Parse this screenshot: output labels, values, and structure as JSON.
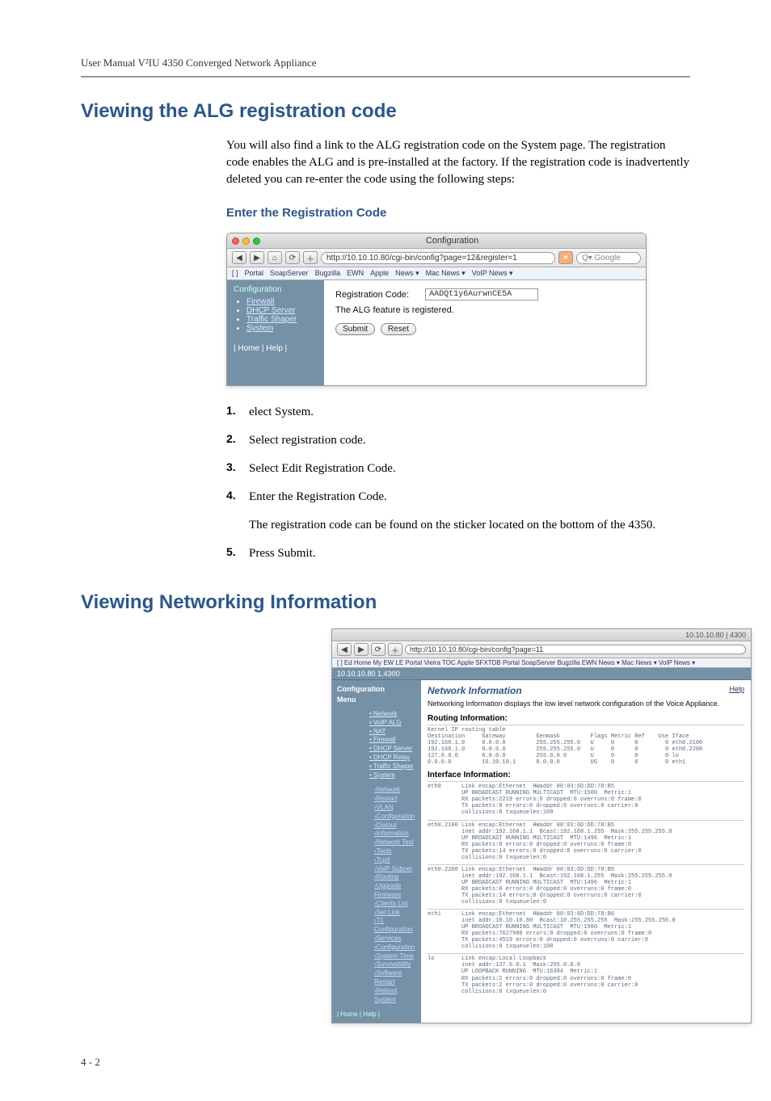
{
  "header": "User Manual V²IU 4350 Converged Network Appliance",
  "h1a": "Viewing the ALG registration code",
  "intro": "You will also find a link to the ALG registration code on the System page. The registration code enables the ALG and is pre-installed at the factory. If the registration code is inadvertently deleted you can re-enter the code using the following steps:",
  "h2": "Enter the Registration Code",
  "shot1": {
    "title": "Configuration",
    "url": "http://10.10.10.80/cgi-bin/config?page=12&register=1",
    "search": "Q▾ Google",
    "bookmarks": [
      "[ ]",
      "Portal",
      "SoapServer",
      "Bugzilla",
      "EWN",
      "Apple",
      "News ▾",
      "Mac News ▾",
      "VoIP News ▾"
    ],
    "sidebar_label": "Configuration",
    "sidebar_items": [
      "Firewall",
      "DHCP Server",
      "Traffic Shaper",
      "System"
    ],
    "side_foot": "| Home | Help |",
    "reg_label": "Registration Code:",
    "reg_value": "AADQt1y6AurwnCE5A",
    "reg_msg": "The ALG feature is registered.",
    "btn_submit": "Submit",
    "btn_reset": "Reset"
  },
  "steps": [
    {
      "n": "1.",
      "t": "elect System."
    },
    {
      "n": "2.",
      "t": "Select registration code."
    },
    {
      "n": "3.",
      "t": "Select Edit Registration Code."
    },
    {
      "n": "4.",
      "t": "Enter the Registration Code."
    }
  ],
  "step_note": "The registration code can be found on the sticker located on the bottom of the 4350.",
  "step5": {
    "n": "5.",
    "t": "Press Submit."
  },
  "h1b": "Viewing Networking Information",
  "shot2": {
    "titleright": "10.10.10.80 | 4300",
    "url": "http://10.10.10.80/cgi-bin/config?page=11",
    "bm": "[ ]  Ed Home  My EW  LE Portal  Vieira TOC  Apple  SFXTDB  Portal  SoapServer  Bugzilla  EWN  News ▾  Mac News ▾  VoIP News ▾",
    "brand": "10.10.10.80 1.4300",
    "sb_head1": "Configuration",
    "sb_head2": "Menu",
    "sb_items": [
      "Network",
      "VoIP ALG",
      "NAT",
      "Firewall",
      "DHCP Server",
      "DHCP Relay",
      "Traffic Shaper",
      "System"
    ],
    "sb_sub": [
      "Network",
      "Restart",
      "VLAN",
      "Configuration",
      "Dialout",
      "Information",
      "Network Test",
      "Tools",
      "Tcpd",
      "VoIP Subnet",
      "Routing",
      "Upgrade Firmware",
      "Clients List",
      "Set Link",
      "T1 Configuration",
      "Services",
      "Configuration",
      "System Time",
      "Survivability",
      "Software Restart",
      "Reboot System"
    ],
    "sb_foot": "| Home | Help |",
    "help": "Help",
    "mp_h3": "Network Information",
    "mp_desc": "Networking Information displays the low level network configuration of the Voice Appliance.",
    "mp_h4a": "Routing Information:",
    "routing": "Kernel IP routing table\nDestination     Gateway         Genmask         Flags Metric Ref    Use Iface\n192.168.1.0     0.0.0.0         255.255.255.0   U     0      0        0 eth0.2100\n192.168.1.0     0.0.0.0         255.255.255.0   U     0      0        0 eth0.2200\n127.0.0.0       0.0.0.0         255.0.0.0       U     0      0        0 lo\n0.0.0.0         10.10.10.1      0.0.0.0         UG    0      0        0 eth1",
    "mp_h4b": "Interface Information:",
    "if_blocks": [
      "eth0      Link encap:Ethernet  HWaddr 00:03:6D:DD:78:B5\n          UP BROADCAST RUNNING MULTICAST  MTU:1500  Metric:1\n          RX packets:2219 errors:0 dropped:0 overruns:0 frame:0\n          TX packets:0 errors:0 dropped:0 overruns:0 carrier:0\n          collisions:0 txqueuelen:100",
      "eth0.2100 Link encap:Ethernet  HWaddr 00:03:6D:DD:78:B5\n          inet addr:192.168.1.1  Bcast:192.168.1.255  Mask:255.255.255.0\n          UP BROADCAST RUNNING MULTICAST  MTU:1496  Metric:1\n          RX packets:0 errors:0 dropped:0 overruns:0 frame:0\n          TX packets:14 errors:0 dropped:0 overruns:0 carrier:0\n          collisions:0 txqueuelen:0",
      "eth0.2200 Link encap:Ethernet  HWaddr 00:03:6D:DD:78:B5\n          inet addr:192.168.1.1  Bcast:192.168.1.255  Mask:255.255.255.0\n          UP BROADCAST RUNNING MULTICAST  MTU:1496  Metric:1\n          RX packets:0 errors:0 dropped:0 overruns:0 frame:0\n          TX packets:14 errors:0 dropped:0 overruns:0 carrier:0\n          collisions:0 txqueuelen:0",
      "eth1      Link encap:Ethernet  HWaddr 00:03:6D:DD:78:B6\n          inet addr:10.10.10.80  Bcast:10.255.255.255  Mask:255.255.255.0\n          UP BROADCAST RUNNING MULTICAST  MTU:1500  Metric:1\n          RX packets:7627980 errors:0 dropped:0 overruns:0 frame:0\n          TX packets:4519 errors:0 dropped:0 overruns:0 carrier:0\n          collisions:0 txqueuelen:100",
      "lo        Link encap:Local Loopback\n          inet addr:127.0.0.1  Mask:255.0.0.0\n          UP LOOPBACK RUNNING  MTU:16384  Metric:1\n          RX packets:2 errors:0 dropped:0 overruns:0 frame:0\n          TX packets:2 errors:0 dropped:0 overruns:0 carrier:0\n          collisions:0 txqueuelen:0"
    ]
  },
  "footer": "4 - 2"
}
